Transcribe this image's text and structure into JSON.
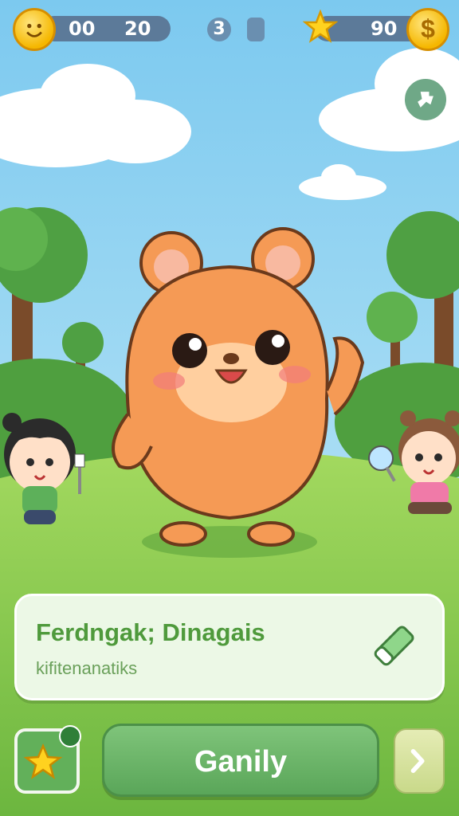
{
  "hud": {
    "coins_left": "00",
    "coins_right": "20",
    "level": "3",
    "stars": "90"
  },
  "card": {
    "title": "Ferdngak; Dinagais",
    "subtitle": "kifitenanatiks"
  },
  "buttons": {
    "main_label": "Ganily"
  },
  "colors": {
    "sky": "#8fd3f0",
    "grass": "#8ccb54",
    "pet": "#f59a55",
    "card_title": "#4f9a3c",
    "main_button": "#62b05a"
  },
  "icons": [
    "smiley-coin-icon",
    "dollar-coin-icon",
    "star-icon",
    "settings-icon",
    "edit-pencil-icon",
    "star-favorite-icon",
    "chevron-right-icon"
  ]
}
